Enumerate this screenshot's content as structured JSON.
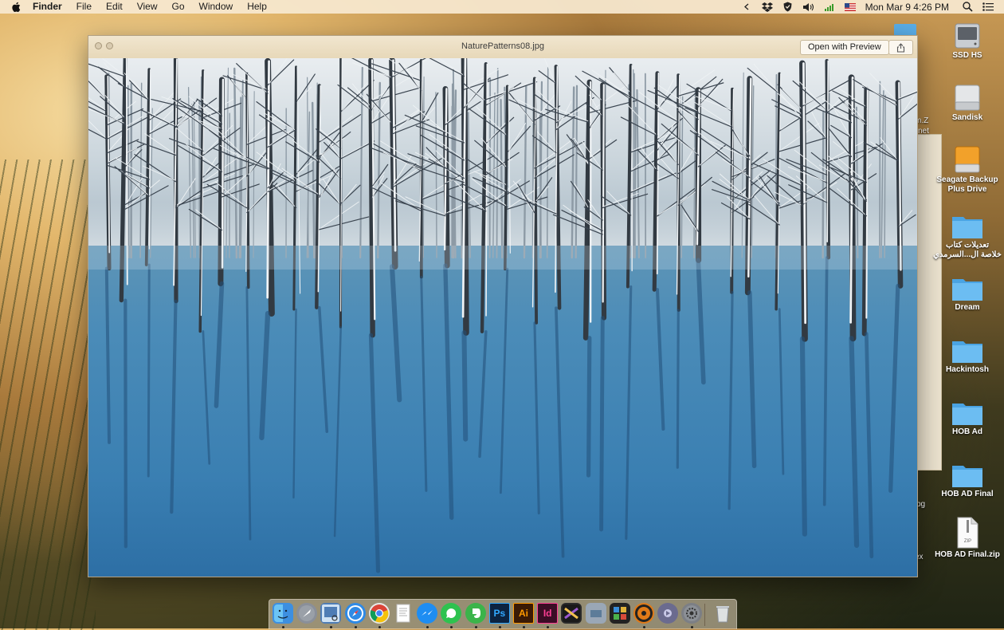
{
  "menubar": {
    "app_name": "Finder",
    "items": [
      "File",
      "Edit",
      "View",
      "Go",
      "Window",
      "Help"
    ],
    "clock": "Mon Mar 9  4:26 PM",
    "status_icons": [
      "chevron-left-icon",
      "dropbox-icon",
      "shield-icon",
      "volume-icon",
      "wifi-signal-icon",
      "us-flag-icon",
      "spotlight-icon",
      "notification-center-icon"
    ]
  },
  "quicklook": {
    "title": "NaturePatterns08.jpg",
    "open_button": "Open with Preview",
    "share_icon": "share-icon"
  },
  "background_peek": {
    "texts": [
      "m.Z",
      "net",
      "pg",
      "ex"
    ]
  },
  "desktop": {
    "items": [
      {
        "label": "SSD HS",
        "icon": "internal-drive-icon"
      },
      {
        "label": "Sandisk",
        "icon": "external-drive-icon"
      },
      {
        "label": "Seagate Backup\nPlus Drive",
        "icon": "external-drive-orange-icon"
      },
      {
        "label": "تعديلات كتاب\nخلاصة ال...السرمدي",
        "icon": "folder-icon"
      },
      {
        "label": "Dream",
        "icon": "folder-icon"
      },
      {
        "label": "Hackintosh",
        "icon": "folder-icon"
      },
      {
        "label": "HOB Ad",
        "icon": "folder-icon"
      },
      {
        "label": "HOB AD Final",
        "icon": "folder-icon"
      },
      {
        "label": "HOB AD Final.zip",
        "icon": "zip-file-icon"
      }
    ]
  },
  "dock": {
    "apps": [
      {
        "name": "finder-icon",
        "glyph": "",
        "color": "#3d8fe0",
        "running": true
      },
      {
        "name": "launchpad-icon",
        "glyph": "",
        "color": "#8a8f99",
        "running": false
      },
      {
        "name": "preview-icon",
        "glyph": "",
        "color": "#4f7db5",
        "running": true
      },
      {
        "name": "safari-icon",
        "glyph": "",
        "color": "#2f8ae5",
        "running": true
      },
      {
        "name": "chrome-icon",
        "glyph": "",
        "color": "#e8e8e8",
        "running": true
      },
      {
        "name": "textedit-icon",
        "glyph": "",
        "color": "#f4f4f4",
        "running": false
      },
      {
        "name": "messenger-icon",
        "glyph": "",
        "color": "#1e8df2",
        "running": true
      },
      {
        "name": "whatsapp-icon",
        "glyph": "",
        "color": "#2ec24f",
        "running": true
      },
      {
        "name": "evernote-icon",
        "glyph": "",
        "color": "#3bb44a",
        "running": true
      },
      {
        "name": "photoshop-icon",
        "glyph": "Ps",
        "color": "#0c2340",
        "running": true
      },
      {
        "name": "illustrator-icon",
        "glyph": "Ai",
        "color": "#3a1a05",
        "running": true
      },
      {
        "name": "indesign-icon",
        "glyph": "Id",
        "color": "#3b0d25",
        "running": true
      },
      {
        "name": "final-cut-icon",
        "glyph": "",
        "color": "#2a2a2a",
        "running": false
      },
      {
        "name": "image-capture-icon",
        "glyph": "",
        "color": "#9aa7b6",
        "running": false
      },
      {
        "name": "photo-booth-icon",
        "glyph": "",
        "color": "#222",
        "running": false
      },
      {
        "name": "dvd-player-icon",
        "glyph": "",
        "color": "#e07a18",
        "running": true
      },
      {
        "name": "imovie-icon",
        "glyph": "",
        "color": "#6b6b8f",
        "running": false
      },
      {
        "name": "system-preferences-icon",
        "glyph": "",
        "color": "#7c7f85",
        "running": true
      },
      {
        "name": "trash-icon",
        "glyph": "",
        "color": "transparent",
        "running": false
      }
    ]
  }
}
